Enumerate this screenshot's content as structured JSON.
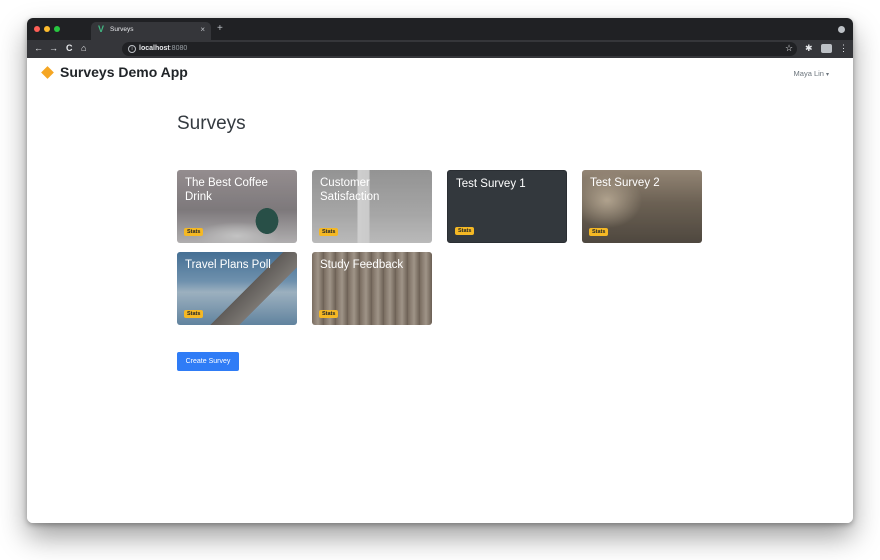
{
  "browser": {
    "tab_title": "Surveys",
    "tab_favicon": "V",
    "tab_close": "×",
    "new_tab": "+",
    "url_host": "localhost",
    "url_port": ":8080",
    "nav_icons": {
      "back": "←",
      "forward": "→",
      "reload": "C",
      "home": "⌂",
      "star": "☆",
      "extensions": "✱",
      "menu": "⋮"
    }
  },
  "navbar": {
    "brand": "Surveys Demo App",
    "user": "Maya Lin",
    "caret": "▾",
    "brand_color": "#f5a623"
  },
  "main": {
    "title": "Surveys",
    "cards": [
      {
        "title": "The Best Coffee Drink",
        "badge": "Stats"
      },
      {
        "title": "Customer Satisfaction",
        "badge": "Stats"
      },
      {
        "title": "Test Survey 1",
        "badge": "Stats"
      },
      {
        "title": "Test Survey 2",
        "badge": "Stats"
      },
      {
        "title": "Travel Plans Poll",
        "badge": "Stats"
      },
      {
        "title": "Study Feedback",
        "badge": "Stats"
      }
    ],
    "create_button": "Create Survey",
    "button_color": "#2f7cf6",
    "badge_color": "#f5b824"
  }
}
